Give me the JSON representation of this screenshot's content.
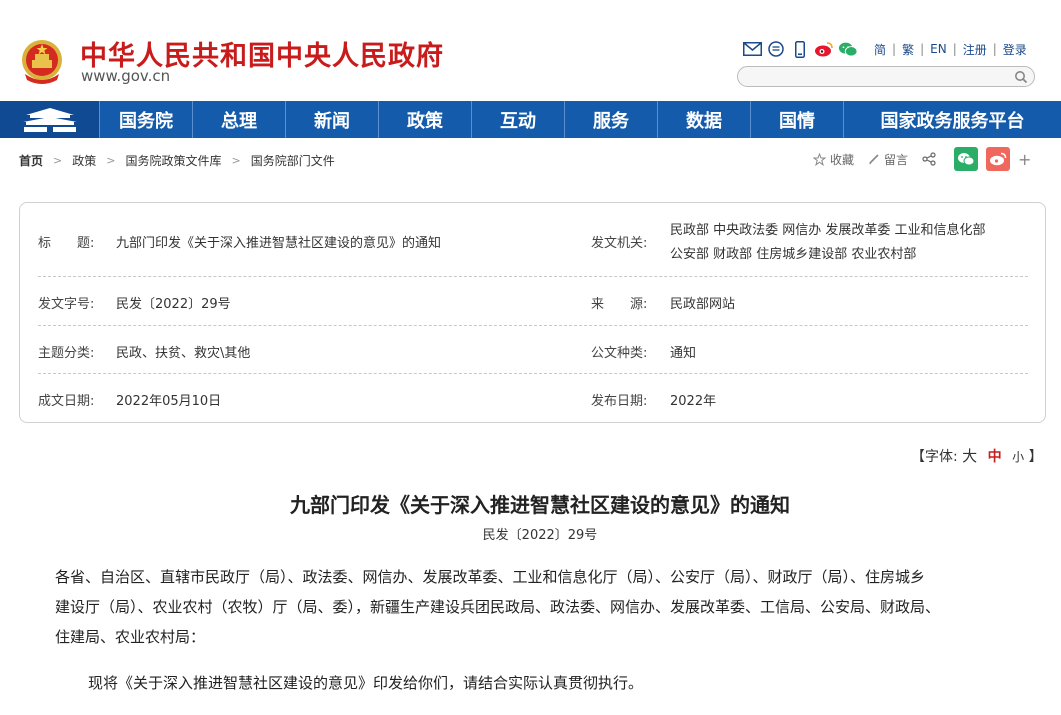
{
  "header": {
    "site_title": "中华人民共和国中央人民政府",
    "site_url": "www.gov.cn",
    "utility_links": [
      "简",
      "繁",
      "EN",
      "注册",
      "登录"
    ],
    "search_placeholder": ""
  },
  "nav": {
    "items": [
      "国务院",
      "总理",
      "新闻",
      "政策",
      "互动",
      "服务",
      "数据",
      "国情",
      "国家政务服务平台"
    ]
  },
  "breadcrumb": [
    "首页",
    "政策",
    "国务院政策文件库",
    "国务院部门文件"
  ],
  "tools": {
    "favorite": "收藏",
    "comment": "留言",
    "more": "+"
  },
  "info": {
    "title_label": "标　　题:",
    "title_value": "九部门印发《关于深入推进智慧社区建设的意见》的通知",
    "issuer_label": "发文机关:",
    "issuer_line1": "民政部  中央政法委  网信办  发展改革委  工业和信息化部",
    "issuer_line2": "公安部  财政部  住房城乡建设部  农业农村部",
    "docno_label": "发文字号:",
    "docno_value": "民发〔2022〕29号",
    "source_label": "来　　源:",
    "source_value": "民政部网站",
    "topic_label": "主题分类:",
    "topic_value": "民政、扶贫、救灾\\其他",
    "type_label": "公文种类:",
    "type_value": "通知",
    "written_label": "成文日期:",
    "written_value": "2022年05月10日",
    "publish_label": "发布日期:",
    "publish_value": "2022年"
  },
  "font_size": {
    "prefix": "【字体:",
    "large": "大",
    "medium": "中",
    "small": "小",
    "suffix": "】"
  },
  "article": {
    "title": "九部门印发《关于深入推进智慧社区建设的意见》的通知",
    "doc_no": "民发〔2022〕29号",
    "para1_line1": "各省、自治区、直辖市民政厅（局）、政法委、网信办、发展改革委、工业和信息化厅（局）、公安厅（局）、财政厅（局）、住房城乡",
    "para1_line2": "建设厅（局）、农业农村（农牧）厅（局、委），新疆生产建设兵团民政局、政法委、网信办、发展改革委、工信局、公安局、财政局、",
    "para1_line3": "住建局、农业农村局：",
    "para2": "现将《关于深入推进智慧社区建设的意见》印发给你们，请结合实际认真贯彻执行。"
  },
  "colors": {
    "brand_red": "#c81c1c",
    "nav_blue": "#155bab",
    "wechat_green": "#2aae67",
    "weibo_red": "#e6162d"
  }
}
